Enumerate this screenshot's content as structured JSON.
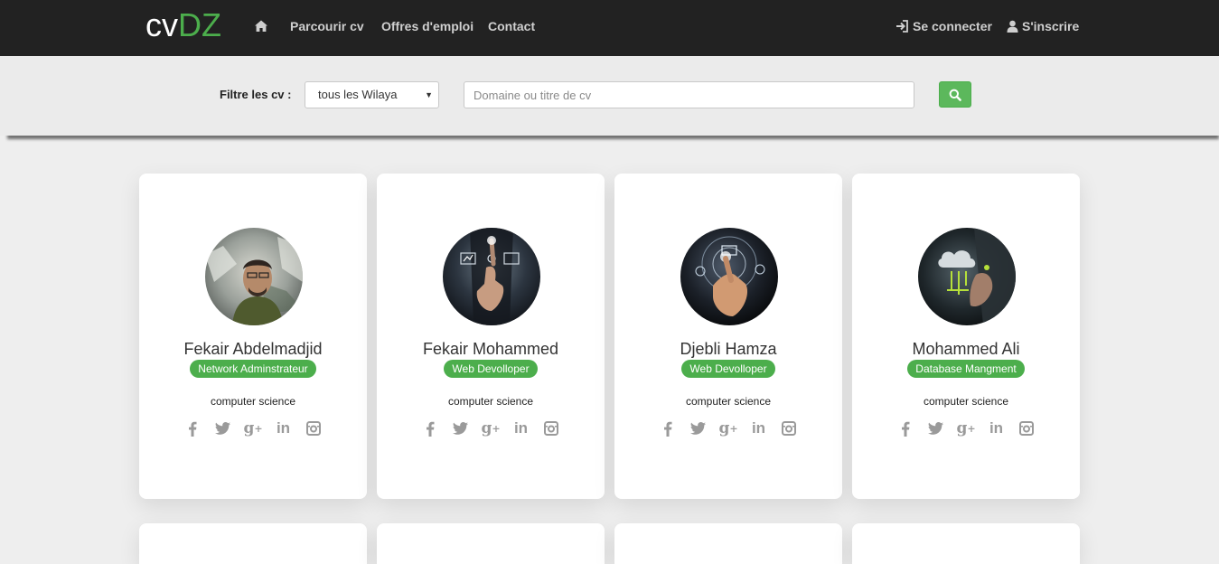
{
  "navbar": {
    "brand_prefix": "cv",
    "brand_accent": "DZ",
    "links": [
      "Parcourir cv",
      "Offres d'emploi",
      "Contact"
    ],
    "login_label": "Se connecter",
    "signup_label": "S'inscrire"
  },
  "filter": {
    "label": "Filtre les cv :",
    "wilaya_selected": "tous les Wilaya",
    "search_placeholder": "Domaine ou titre de cv"
  },
  "cards": [
    {
      "name": "Fekair Abdelmadjid",
      "title": "Network Adminstrateur",
      "field": "computer science",
      "avatar": "photo-person"
    },
    {
      "name": "Fekair Mohammed",
      "title": "Web Devolloper",
      "field": "computer science",
      "avatar": "tech-touch"
    },
    {
      "name": "Djebli Hamza",
      "title": "Web Devolloper",
      "field": "computer science",
      "avatar": "tech-touch-hud"
    },
    {
      "name": "Mohammed Ali",
      "title": "Database Mangment",
      "field": "computer science",
      "avatar": "cloud-tech"
    }
  ],
  "socials": {
    "facebook": "f",
    "twitter": "twitter-icon",
    "google_plus": "g+",
    "linkedin": "in",
    "instagram": "instagram-icon"
  },
  "colors": {
    "navbar_bg": "#222222",
    "accent": "#4cae4c",
    "button": "#5cb85c",
    "page_bg": "#eeeeee"
  }
}
